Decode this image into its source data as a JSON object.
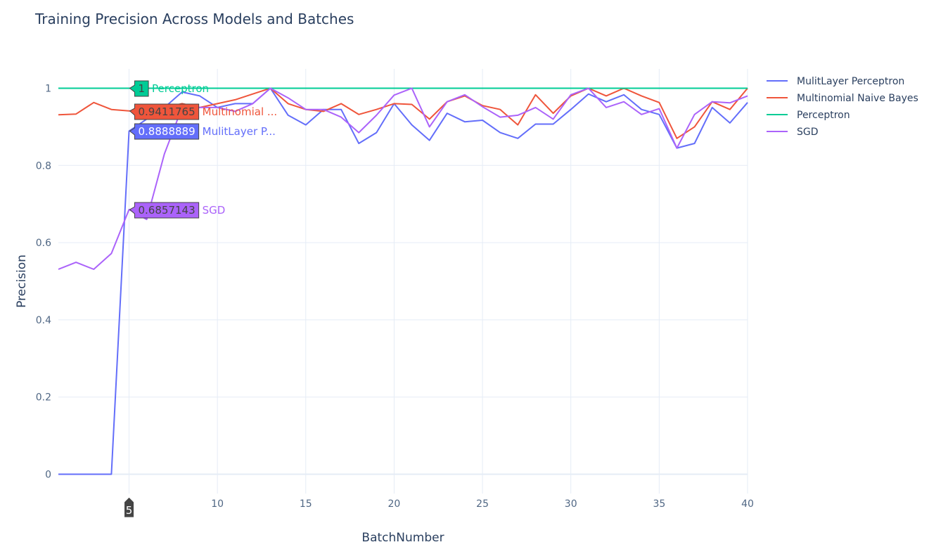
{
  "chart_data": {
    "type": "line",
    "title": "Training Precision Across Models and Batches",
    "xlabel": "BatchNumber",
    "ylabel": "Precision",
    "xlim": [
      1,
      40
    ],
    "ylim": [
      -0.05,
      1.05
    ],
    "xticks": [
      5,
      10,
      15,
      20,
      25,
      30,
      35,
      40
    ],
    "yticks": [
      0,
      0.2,
      0.4,
      0.6,
      0.8,
      1
    ],
    "ytick_labels": [
      "0",
      "0.2",
      "0.4",
      "0.6",
      "0.8",
      "1"
    ],
    "grid": true,
    "legend_position": "top-right",
    "x": [
      1,
      2,
      3,
      4,
      5,
      6,
      7,
      8,
      9,
      10,
      11,
      12,
      13,
      14,
      15,
      16,
      17,
      18,
      19,
      20,
      21,
      22,
      23,
      24,
      25,
      26,
      27,
      28,
      29,
      30,
      31,
      32,
      33,
      34,
      35,
      36,
      37,
      38,
      39,
      40
    ],
    "series": [
      {
        "name": "MulitLayer Perceptron",
        "color": "#636efa",
        "values": [
          0,
          0,
          0,
          0,
          0.8888889,
          0.92,
          0.95,
          0.99,
          0.98,
          0.95,
          0.96,
          0.96,
          1.0,
          0.93,
          0.905,
          0.945,
          0.945,
          0.857,
          0.885,
          0.96,
          0.905,
          0.865,
          0.935,
          0.913,
          0.917,
          0.885,
          0.87,
          0.907,
          0.907,
          0.945,
          0.985,
          0.965,
          0.983,
          0.945,
          0.932,
          0.845,
          0.857,
          0.95,
          0.91,
          0.963
        ]
      },
      {
        "name": "Multinomial Naive Bayes",
        "color": "#EF553B",
        "values": [
          0.931,
          0.933,
          0.963,
          0.945,
          0.9411765,
          0.94,
          0.95,
          0.96,
          0.95,
          0.96,
          0.97,
          0.985,
          1.0,
          0.96,
          0.945,
          0.94,
          0.96,
          0.932,
          0.945,
          0.96,
          0.958,
          0.92,
          0.965,
          0.98,
          0.955,
          0.945,
          0.905,
          0.983,
          0.935,
          0.98,
          1.0,
          0.98,
          1.0,
          0.98,
          0.963,
          0.87,
          0.9,
          0.965,
          0.945,
          1.0
        ]
      },
      {
        "name": "Perceptron",
        "color": "#00cc96",
        "values": [
          1,
          1,
          1,
          1,
          1,
          1,
          1,
          1,
          1,
          1,
          1,
          1,
          1,
          1,
          1,
          1,
          1,
          1,
          1,
          1,
          1,
          1,
          1,
          1,
          1,
          1,
          1,
          1,
          1,
          1,
          1,
          1,
          1,
          1,
          1,
          1,
          1,
          1,
          1,
          1
        ]
      },
      {
        "name": "SGD",
        "color": "#ab63fa",
        "values": [
          0.531,
          0.549,
          0.531,
          0.572,
          0.6857143,
          0.66,
          0.83,
          0.95,
          0.95,
          0.95,
          0.94,
          0.96,
          1.0,
          0.975,
          0.945,
          0.945,
          0.925,
          0.885,
          0.93,
          0.982,
          1.0,
          0.9,
          0.965,
          0.983,
          0.952,
          0.925,
          0.93,
          0.95,
          0.92,
          0.983,
          1.0,
          0.95,
          0.965,
          0.932,
          0.947,
          0.845,
          0.932,
          0.965,
          0.962,
          0.98
        ]
      }
    ],
    "hover": {
      "x_label": "5",
      "items": [
        {
          "value": "1",
          "series": "Perceptron",
          "y": 1,
          "color": "#00cc96",
          "text_color": "#00cc96",
          "value_color": "#444444"
        },
        {
          "value": "0.9411765",
          "series": "Multinomial ...",
          "y": 0.9411765,
          "color": "#EF553B",
          "text_color": "#EF553B",
          "value_color": "#444444"
        },
        {
          "value": "0.8888889",
          "series": "MulitLayer P...",
          "y": 0.8888889,
          "color": "#636efa",
          "text_color": "#636efa",
          "value_color": "#ffffff"
        },
        {
          "value": "0.6857143",
          "series": "SGD",
          "y": 0.6857143,
          "color": "#ab63fa",
          "text_color": "#ab63fa",
          "value_color": "#444444"
        }
      ]
    }
  }
}
